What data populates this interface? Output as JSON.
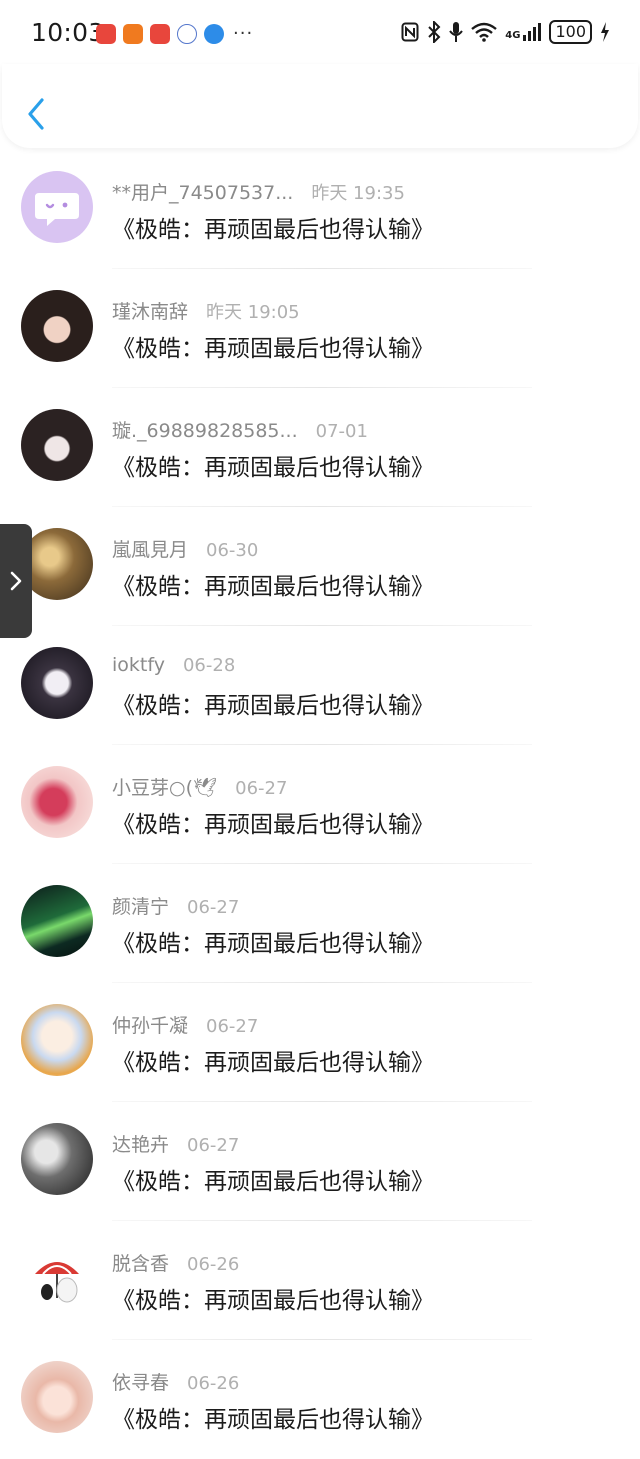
{
  "status_bar": {
    "time": "10:03",
    "more": "···",
    "network": "4G",
    "battery": "100"
  },
  "header": {
    "back_icon": "chevron-left-icon"
  },
  "colors": {
    "accent": "#2aa0ea",
    "name_gray": "#8a8a8a",
    "time_gray": "#b0b0b0",
    "message_text": "#1c1c1c"
  },
  "list": [
    {
      "name": "**用户_74507537...",
      "time": "昨天 19:35",
      "message": "《极皓：再顽固最后也得认输》",
      "avatar": "chat-bubble-avatar"
    },
    {
      "name": "瑾沐南辞",
      "time": "昨天 19:05",
      "message": "《极皓：再顽固最后也得认输》",
      "avatar": "user-avatar"
    },
    {
      "name": "璇._69889828585...",
      "time": "07-01",
      "message": "《极皓：再顽固最后也得认输》",
      "avatar": "user-avatar"
    },
    {
      "name": "嵐風見月",
      "time": "06-30",
      "message": "《极皓：再顽固最后也得认输》",
      "avatar": "user-avatar"
    },
    {
      "name": "ioktfy",
      "time": "06-28",
      "message": "《极皓：再顽固最后也得认输》",
      "avatar": "user-avatar"
    },
    {
      "name": "小豆芽○(🕊",
      "time": "06-27",
      "message": "《极皓：再顽固最后也得认输》",
      "avatar": "user-avatar"
    },
    {
      "name": "颜清宁",
      "time": "06-27",
      "message": "《极皓：再顽固最后也得认输》",
      "avatar": "user-avatar"
    },
    {
      "name": "仲孙千凝",
      "time": "06-27",
      "message": "《极皓：再顽固最后也得认输》",
      "avatar": "user-avatar"
    },
    {
      "name": "达艳卉",
      "time": "06-27",
      "message": "《极皓：再顽固最后也得认输》",
      "avatar": "user-avatar"
    },
    {
      "name": "脱含香",
      "time": "06-26",
      "message": "《极皓：再顽固最后也得认输》",
      "avatar": "user-avatar"
    },
    {
      "name": "依寻春",
      "time": "06-26",
      "message": "《极皓：再顽固最后也得认输》",
      "avatar": "user-avatar"
    }
  ],
  "side_handle": {
    "icon": "chevron-right-icon"
  }
}
